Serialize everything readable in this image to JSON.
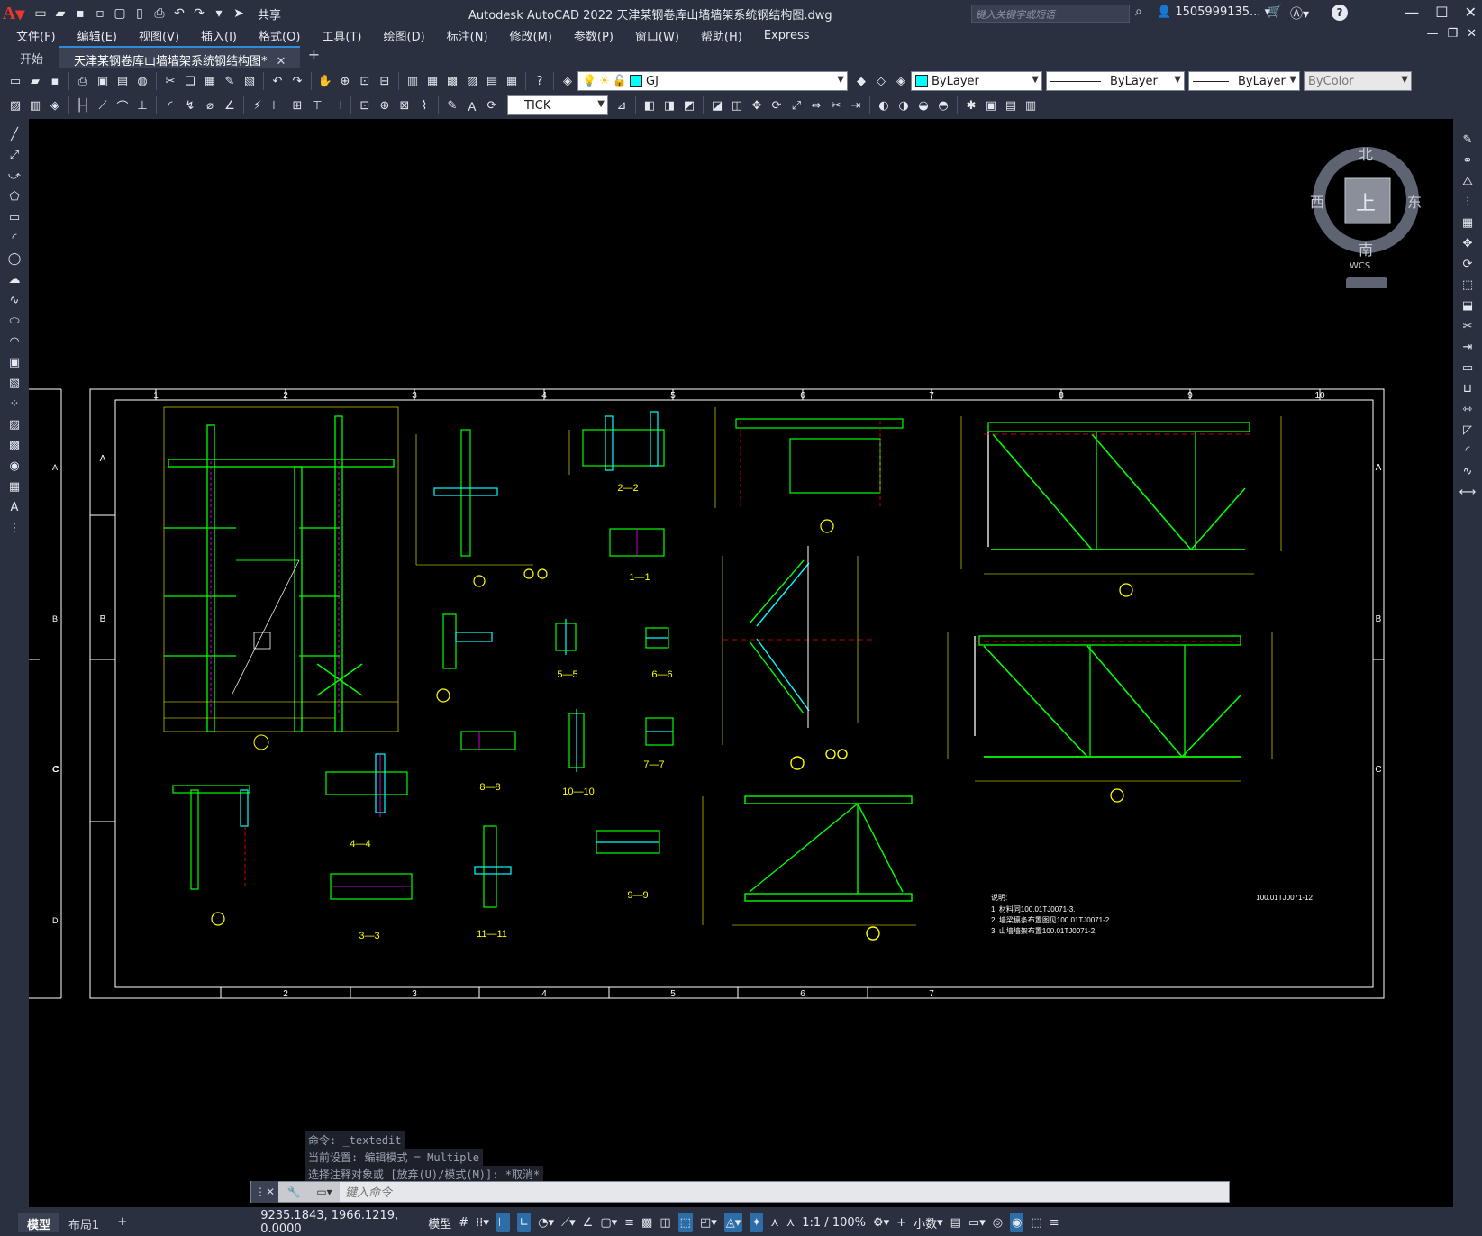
{
  "app": {
    "logo_letter": "A",
    "title": "Autodesk AutoCAD 2022    天津某钢卷库山墙墙架系统钢结构图.dwg",
    "share_label": "共享",
    "search_placeholder": "键入关键字或短语",
    "user_label": "1505999135...",
    "window_controls": [
      "—",
      "☐",
      "✕"
    ]
  },
  "menu": [
    "文件(F)",
    "编辑(E)",
    "视图(V)",
    "插入(I)",
    "格式(O)",
    "工具(T)",
    "绘图(D)",
    "标注(N)",
    "修改(M)",
    "参数(P)",
    "窗口(W)",
    "帮助(H)",
    "Express"
  ],
  "file_tabs": {
    "start_label": "开始",
    "doc_label": "天津某钢卷库山墙墙架系统钢结构图*",
    "add_label": "+"
  },
  "properties": {
    "layer": "GJ",
    "layer_color": "#00ffff",
    "color": "ByLayer",
    "linetype": "ByLayer",
    "lineweight": "ByLayer",
    "plotstyle": "ByColor",
    "dimstyle": "TICK"
  },
  "viewcube": {
    "north": "北",
    "south": "南",
    "east": "东",
    "west": "西",
    "face": "上",
    "wcs": "WCS"
  },
  "drawing": {
    "column_numbers_top": [
      "1",
      "2",
      "3",
      "4",
      "5",
      "6",
      "7",
      "8",
      "9",
      "10"
    ],
    "column_numbers_bottom": [
      "2",
      "3",
      "4",
      "5",
      "6",
      "7"
    ],
    "row_letters": [
      "A",
      "B",
      "C",
      "D"
    ],
    "section_labels": [
      "2—2",
      "1—1",
      "5—5",
      "6—6",
      "7—7",
      "8—8",
      "10—10",
      "4—4",
      "9—9",
      "3—3",
      "11—11"
    ],
    "notes_title": "说明:",
    "notes": [
      "1. 材料同100.01TJ0071-3.",
      "2. 墙梁檩条布置图见100.01TJ0071-2.",
      "3. 山墙墙架布置100.01TJ0071-2."
    ],
    "drawing_number": "100.01TJ0071-12"
  },
  "command": {
    "history": [
      "命令: _textedit",
      "当前设置: 编辑模式 = Multiple",
      "选择注释对象或 [放弃(U)/模式(M)]: *取消*"
    ],
    "placeholder": "键入命令"
  },
  "status": {
    "layout_tabs": [
      "模型",
      "布局1"
    ],
    "add_layout": "+",
    "coordinates": "9235.1843, 1966.1219, 0.0000",
    "model_label": "模型",
    "scale": "1:1 / 100%",
    "units": "小数"
  },
  "colors": {
    "bg_dark": "#2b3040",
    "canvas": "#000000",
    "cad_green": "#00ff00",
    "cad_yellow": "#ffff00",
    "cad_cyan": "#00ffff",
    "cad_magenta": "#ff00ff",
    "cad_red": "#ff0000",
    "cad_white": "#ffffff",
    "accent": "#2e8bd8"
  }
}
